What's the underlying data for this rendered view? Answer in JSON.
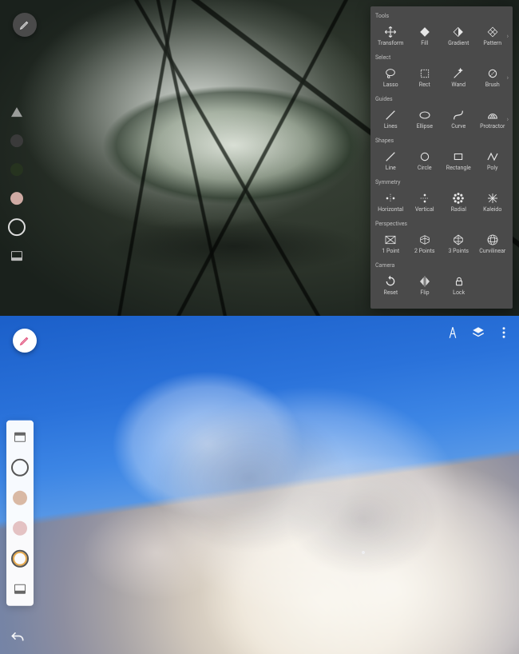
{
  "top_app": {
    "fab_icon": "pencil-icon",
    "sidebar": {
      "items": [
        {
          "name": "shape-triangle-icon",
          "kind": "triangle"
        },
        {
          "name": "color-swatch-1",
          "kind": "dot",
          "color": "#3a3a3a"
        },
        {
          "name": "color-swatch-2",
          "kind": "dot",
          "color": "#26331f"
        },
        {
          "name": "color-swatch-3",
          "kind": "dot",
          "color": "#cfaaa3"
        },
        {
          "name": "brush-size-ring",
          "kind": "ring"
        },
        {
          "name": "layers-panel-icon",
          "kind": "panel"
        }
      ]
    },
    "panel": {
      "sections": [
        {
          "label": "Tools",
          "caret": true,
          "items": [
            {
              "name": "tool-transform",
              "label": "Transform",
              "icon": "move-icon"
            },
            {
              "name": "tool-fill",
              "label": "Fill",
              "icon": "diamond-icon"
            },
            {
              "name": "tool-gradient",
              "label": "Gradient",
              "icon": "diamond-half-icon"
            },
            {
              "name": "tool-pattern",
              "label": "Pattern",
              "icon": "diamond-grid-icon"
            }
          ]
        },
        {
          "label": "Select",
          "caret": true,
          "items": [
            {
              "name": "select-lasso",
              "label": "Lasso",
              "icon": "lasso-icon"
            },
            {
              "name": "select-rect",
              "label": "Rect",
              "icon": "rect-dashed-icon"
            },
            {
              "name": "select-wand",
              "label": "Wand",
              "icon": "wand-icon"
            },
            {
              "name": "select-brush",
              "label": "Brush",
              "icon": "brush-circle-icon"
            }
          ]
        },
        {
          "label": "Guides",
          "caret": true,
          "items": [
            {
              "name": "guide-lines",
              "label": "Lines",
              "icon": "line-icon"
            },
            {
              "name": "guide-ellipse",
              "label": "Ellipse",
              "icon": "ellipse-icon"
            },
            {
              "name": "guide-curve",
              "label": "Curve",
              "icon": "curve-icon"
            },
            {
              "name": "guide-protractor",
              "label": "Protractor",
              "icon": "protractor-icon"
            }
          ]
        },
        {
          "label": "Shapes",
          "caret": false,
          "items": [
            {
              "name": "shape-line",
              "label": "Line",
              "icon": "line-icon"
            },
            {
              "name": "shape-circle",
              "label": "Circle",
              "icon": "circle-icon"
            },
            {
              "name": "shape-rectangle",
              "label": "Rectangle",
              "icon": "rectangle-icon"
            },
            {
              "name": "shape-poly",
              "label": "Poly",
              "icon": "polyline-icon"
            }
          ]
        },
        {
          "label": "Symmetry",
          "caret": false,
          "items": [
            {
              "name": "sym-horizontal",
              "label": "Horizontal",
              "icon": "sym-horizontal-icon"
            },
            {
              "name": "sym-vertical",
              "label": "Vertical",
              "icon": "sym-vertical-icon"
            },
            {
              "name": "sym-radial",
              "label": "Radial",
              "icon": "sym-radial-icon"
            },
            {
              "name": "sym-kaleido",
              "label": "Kaleido",
              "icon": "sym-kaleido-icon"
            }
          ]
        },
        {
          "label": "Perspectives",
          "caret": false,
          "items": [
            {
              "name": "persp-1pt",
              "label": "1 Point",
              "icon": "grid-1pt-icon"
            },
            {
              "name": "persp-2pt",
              "label": "2 Points",
              "icon": "grid-2pt-icon"
            },
            {
              "name": "persp-3pt",
              "label": "3 Points",
              "icon": "grid-3pt-icon"
            },
            {
              "name": "persp-curv",
              "label": "Curvilinear",
              "icon": "globe-grid-icon"
            }
          ]
        },
        {
          "label": "Camera",
          "caret": false,
          "cam": true,
          "items": [
            {
              "name": "camera-reset",
              "label": "Reset",
              "icon": "reset-icon"
            },
            {
              "name": "camera-flip",
              "label": "Flip",
              "icon": "flip-icon"
            },
            {
              "name": "camera-lock",
              "label": "Lock",
              "icon": "lock-icon"
            }
          ]
        }
      ]
    }
  },
  "bottom_app": {
    "fab_icon": "pencil-icon",
    "top_right": [
      {
        "name": "guides-toggle-icon",
        "icon": "compass-icon"
      },
      {
        "name": "layers-icon",
        "icon": "layers-stack-icon"
      },
      {
        "name": "overflow-menu-icon",
        "icon": "kebab-icon"
      }
    ],
    "sidebar": {
      "items": [
        {
          "name": "panel-top-icon",
          "kind": "panel-top"
        },
        {
          "name": "brush-ring-1",
          "kind": "ring"
        },
        {
          "name": "color-swatch-1",
          "kind": "disc",
          "color": "#d9b9a4"
        },
        {
          "name": "color-swatch-2",
          "kind": "disc",
          "color": "#e4c2c3"
        },
        {
          "name": "brush-size-ring-accent",
          "kind": "ring-accent"
        },
        {
          "name": "panel-bottom-icon",
          "kind": "panel-bottom"
        }
      ]
    },
    "undo_icon": "undo-icon"
  }
}
